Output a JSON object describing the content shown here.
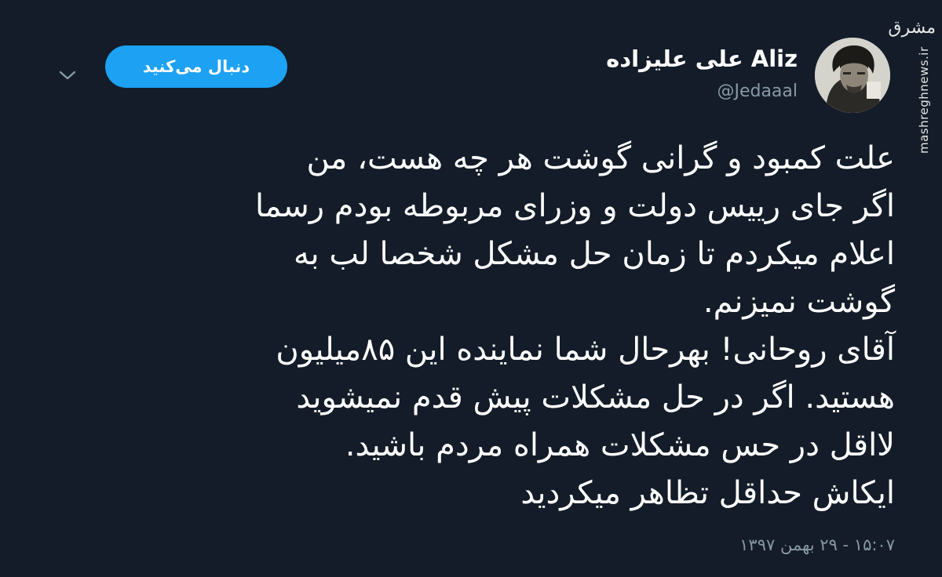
{
  "user": {
    "display_name": "Aliz علی علیزاده",
    "handle": "@Jedaaal"
  },
  "actions": {
    "follow_label": "دنبال می‌کنید"
  },
  "icons": {
    "caret": "chevron-down-icon",
    "avatar": "avatar"
  },
  "tweet": {
    "lines": [
      "علت کمبود و گرانی گوشت هر چه هست، من",
      "اگر جای رییس دولت و وزرای مربوطه بودم رسما",
      "اعلام میکردم تا زمان حل مشکل شخصا لب به",
      "گوشت نمیزنم.",
      "آقای روحانی! بهرحال شما نماینده این ۸۵میلیون",
      "هستید. اگر در حل مشکلات پیش قدم نمیشوید",
      "لااقل در حس مشکلات همراه مردم باشید.",
      "ایکاش حداقل تظاهر میکردید"
    ],
    "timestamp": "۱۵:۰۷ - ۲۹ بهمن ۱۳۹۷"
  },
  "watermark": {
    "logo_text": "مشرق",
    "site": "mashreghnews.ir"
  },
  "colors": {
    "background": "#131c28",
    "accent": "#1da1f2",
    "secondary_text": "#8899a6",
    "primary_text": "#ffffff"
  }
}
